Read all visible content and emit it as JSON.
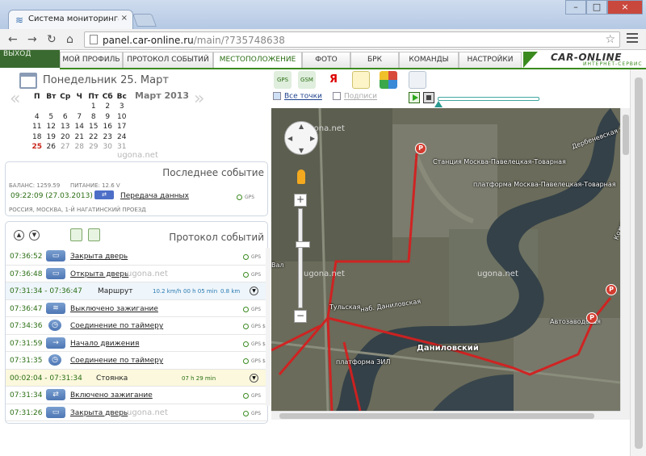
{
  "browser": {
    "tab_title": "Система мониторинга С",
    "tab_close": "×",
    "url_host": "panel.car-online.ru",
    "url_path": "/main/?735748638",
    "win_min": "–",
    "win_max": "□",
    "win_close": "×"
  },
  "site": {
    "exit_label": "ВЫХОД",
    "tabs": [
      "Мой профиль",
      "Протокол событий",
      "Местоположение",
      "Фото",
      "БРК",
      "Команды",
      "Настройки"
    ],
    "active_tab": "Местоположение",
    "logo_text": "CAR-ONLINE",
    "logo_sub": "ИНТЕРНЕТ-СЕРВИС",
    "accent_color": "#3a8a1f"
  },
  "calendar": {
    "title": "Понедельник 25. Март",
    "month_year": "Март 2013",
    "weekdays": [
      "П",
      "Вт",
      "Ср",
      "Ч",
      "Пт",
      "Сб",
      "Вс"
    ],
    "weeks": [
      [
        "",
        "",
        "",
        "",
        "1",
        "2",
        "3"
      ],
      [
        "4",
        "5",
        "6",
        "7",
        "8",
        "9",
        "10"
      ],
      [
        "11",
        "12",
        "13",
        "14",
        "15",
        "16",
        "17"
      ],
      [
        "18",
        "19",
        "20",
        "21",
        "22",
        "23",
        "24"
      ],
      [
        "25",
        "26",
        "27",
        "28",
        "29",
        "30",
        "31"
      ]
    ],
    "today": "25",
    "prev_arrow": "«",
    "next_arrow": "»"
  },
  "watermark": "ugona.net",
  "last_event": {
    "title": "Последнее событие",
    "balance": "БАЛАНС: 1259.59",
    "power": "ПИТАНИЕ: 12.6 V",
    "time": "09:22:09 (27.03.2013)",
    "label": "Передача данных",
    "gps": "GPS",
    "address": "РОССИЯ, МОСКВА, 1-Й НАГАТИНСКИЙ ПРОЕЗД"
  },
  "protocol": {
    "title": "Протокол событий",
    "rows": [
      {
        "time": "07:36:52",
        "label": "Закрыта дверь",
        "gps": "GPS",
        "type": "event"
      },
      {
        "time": "07:36:48",
        "label": "Открыта дверь",
        "gps": "GPS",
        "type": "event"
      },
      {
        "time": "07:31:34 - 07:36:47",
        "label": "Маршрут",
        "speed": "10.2 km/h",
        "duration": "00 h 05 min",
        "distance": "0.8 km",
        "type": "route"
      },
      {
        "time": "07:36:47",
        "label": "Выключено зажигание",
        "gps": "GPS",
        "type": "event"
      },
      {
        "time": "07:34:36",
        "label": "Соединение по таймеру",
        "gps": "GPS $",
        "type": "event"
      },
      {
        "time": "07:31:59",
        "label": "Начало движения",
        "gps": "GPS $",
        "type": "event"
      },
      {
        "time": "07:31:35",
        "label": "Соединение по таймеру",
        "gps": "GPS $",
        "type": "event"
      },
      {
        "time": "00:02:04 - 07:31:34",
        "label": "Стоянка",
        "duration": "07 h 29 min",
        "type": "stop"
      },
      {
        "time": "07:31:34",
        "label": "Включено зажигание",
        "gps": "GPS",
        "type": "event"
      },
      {
        "time": "07:31:26",
        "label": "Закрыта дверь",
        "gps": "GPS",
        "type": "event"
      }
    ]
  },
  "map_panel": {
    "tools": [
      "GPS",
      "GSM",
      "Я",
      "",
      "",
      ""
    ],
    "all_points": "Все точки",
    "captions": "Подписи",
    "zoom_in": "+",
    "zoom_out": "−",
    "labels": [
      "Станция Москва-Павелецкая-Товарная",
      "платформа Москва-Павелецкая-Товарная",
      "Дербеневская наб.",
      "Кожевническая ул.",
      "Тульская",
      "наб. Даниловская",
      "Даниловский",
      "Автозаводская",
      "платформа ЗИЛ",
      "Вал"
    ],
    "pin_letter": "P"
  }
}
